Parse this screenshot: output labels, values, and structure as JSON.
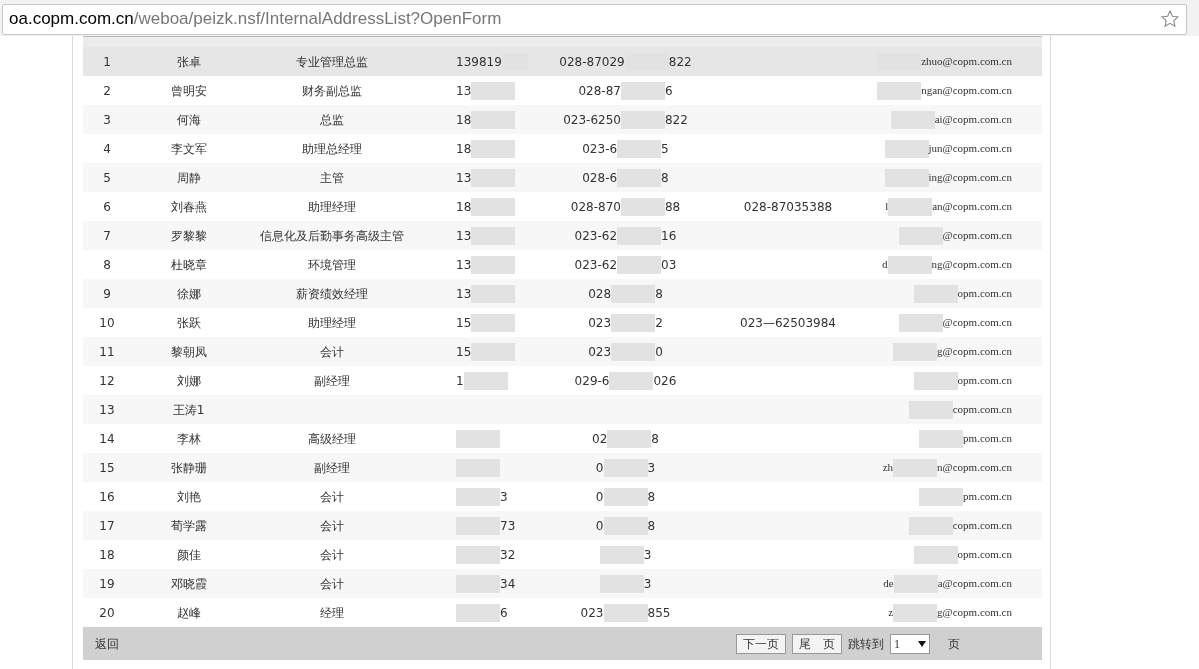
{
  "address_bar": {
    "host": "oa.copm.com.cn",
    "path": "/weboa/peizk.nsf/InternalAddressList?OpenForm"
  },
  "table": {
    "rows": [
      {
        "no": "1",
        "name": "张卓",
        "title": "专业管理总监",
        "selected": true,
        "phone": {
          "start": "139819"
        },
        "office": {
          "start": "028-87029",
          "end": "822"
        },
        "email": {
          "end": "zhuo@copm.com.cn"
        }
      },
      {
        "no": "2",
        "name": "曾明安",
        "title": "财务副总监",
        "selected": false,
        "phone": {
          "start": "13"
        },
        "office": {
          "start": "028-87",
          "end": "6"
        },
        "email": {
          "end": "ngan@copm.com.cn"
        }
      },
      {
        "no": "3",
        "name": "何海",
        "title": "总监",
        "selected": false,
        "phone": {
          "start": "18"
        },
        "office": {
          "start": "023-6250",
          "end": "822"
        },
        "email": {
          "end": "ai@copm.com.cn"
        }
      },
      {
        "no": "4",
        "name": "李文军",
        "title": "助理总经理",
        "selected": false,
        "phone": {
          "start": "18"
        },
        "office": {
          "start": "023-6",
          "end": "5"
        },
        "email": {
          "end": "jun@copm.com.cn"
        }
      },
      {
        "no": "5",
        "name": "周静",
        "title": "主管",
        "selected": false,
        "phone": {
          "start": "13"
        },
        "office": {
          "start": "028-6",
          "end": "8"
        },
        "email": {
          "end": "ing@copm.com.cn"
        }
      },
      {
        "no": "6",
        "name": "刘春燕",
        "title": "助理经理",
        "selected": false,
        "phone": {
          "start": "18"
        },
        "office": {
          "start": "028-870",
          "end": "88"
        },
        "fax": "028-87035388",
        "email": {
          "start": "l",
          "end": "an@copm.com.cn"
        }
      },
      {
        "no": "7",
        "name": "罗黎黎",
        "title": "信息化及后勤事务高级主管",
        "selected": false,
        "phone": {
          "start": "13"
        },
        "office": {
          "start": "023-62",
          "end": "16"
        },
        "email": {
          "end": "@copm.com.cn"
        }
      },
      {
        "no": "8",
        "name": "杜晓章",
        "title": "环境管理",
        "selected": false,
        "phone": {
          "start": "13"
        },
        "office": {
          "start": "023-62",
          "end": "03"
        },
        "email": {
          "start": "d",
          "end": "ng@copm.com.cn"
        }
      },
      {
        "no": "9",
        "name": "徐娜",
        "title": "薪资绩效经理",
        "selected": false,
        "phone": {
          "start": "13"
        },
        "office": {
          "start": "028",
          "end": "8"
        },
        "email": {
          "end": "opm.com.cn"
        }
      },
      {
        "no": "10",
        "name": "张跃",
        "title": "助理经理",
        "selected": false,
        "phone": {
          "start": "15"
        },
        "office": {
          "start": "023",
          "end": "2"
        },
        "fax": "023—62503984",
        "email": {
          "end": "@copm.com.cn"
        }
      },
      {
        "no": "11",
        "name": "黎朝凤",
        "title": "会计",
        "selected": false,
        "phone": {
          "start": "15"
        },
        "office": {
          "start": "023",
          "end": "0"
        },
        "email": {
          "end": "g@copm.com.cn"
        }
      },
      {
        "no": "12",
        "name": "刘娜",
        "title": "副经理",
        "selected": false,
        "phone": {
          "start": "1"
        },
        "office": {
          "start": "029-6",
          "end": "026"
        },
        "email": {
          "end": "opm.com.cn"
        }
      },
      {
        "no": "13",
        "name": "王涛1",
        "selected": false,
        "email": {
          "end": "copm.com.cn"
        }
      },
      {
        "no": "14",
        "name": "李林",
        "title": "高级经理",
        "selected": false,
        "phone": {},
        "office": {
          "start": "02",
          "end": "8"
        },
        "email": {
          "end": "pm.com.cn"
        }
      },
      {
        "no": "15",
        "name": "张静珊",
        "title": "副经理",
        "selected": false,
        "phone": {},
        "office": {
          "start": "0",
          "end": "3"
        },
        "email": {
          "start": "zh",
          "end": "n@copm.com.cn"
        }
      },
      {
        "no": "16",
        "name": "刘艳",
        "title": "会计",
        "selected": false,
        "phone": {
          "end": "3"
        },
        "office": {
          "start": "0",
          "end": "8"
        },
        "email": {
          "end": "pm.com.cn"
        }
      },
      {
        "no": "17",
        "name": "荀学露",
        "title": "会计",
        "selected": false,
        "phone": {
          "end": "73"
        },
        "office": {
          "start": "0",
          "end": "8"
        },
        "email": {
          "end": "copm.com.cn"
        }
      },
      {
        "no": "18",
        "name": "颜佳",
        "title": "会计",
        "selected": false,
        "phone": {
          "end": "32"
        },
        "office": {
          "end": "3"
        },
        "email": {
          "end": "opm.com.cn"
        }
      },
      {
        "no": "19",
        "name": "邓晓霞",
        "title": "会计",
        "selected": false,
        "phone": {
          "end": "34"
        },
        "office": {
          "end": "3"
        },
        "email": {
          "start": "de",
          "end": "a@copm.com.cn"
        }
      },
      {
        "no": "20",
        "name": "赵峰",
        "title": "经理",
        "selected": false,
        "phone": {
          "end": "6"
        },
        "office": {
          "start": "023",
          "end": "855"
        },
        "email": {
          "start": "z",
          "end": "g@copm.com.cn"
        }
      }
    ]
  },
  "footer": {
    "back_link": "返回",
    "next_button": "下一页",
    "last_button": "尾　页",
    "jump_label": "跳转到",
    "page_select": "1",
    "page_unit": "页"
  }
}
